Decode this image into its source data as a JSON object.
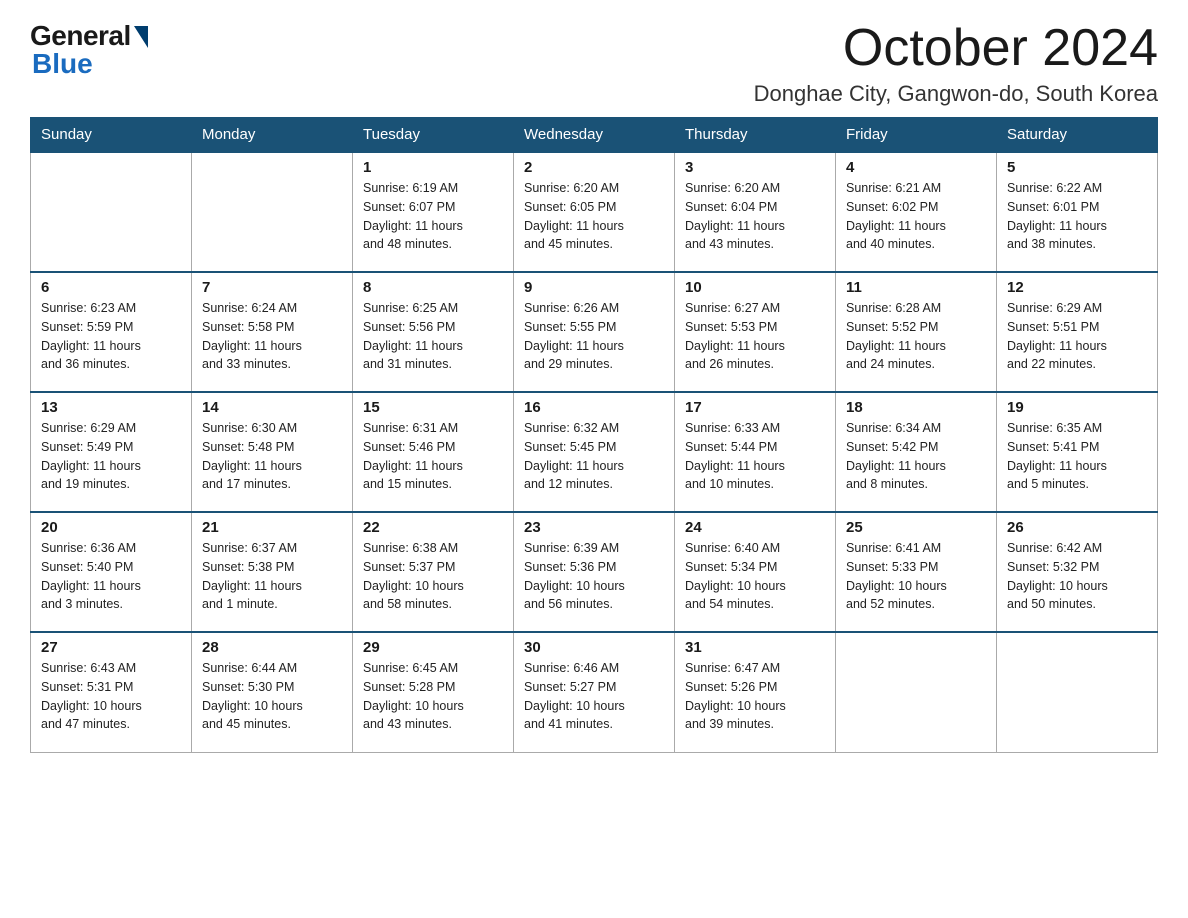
{
  "header": {
    "logo_general": "General",
    "logo_blue": "Blue",
    "month": "October 2024",
    "location": "Donghae City, Gangwon-do, South Korea"
  },
  "days_of_week": [
    "Sunday",
    "Monday",
    "Tuesday",
    "Wednesday",
    "Thursday",
    "Friday",
    "Saturday"
  ],
  "weeks": [
    [
      {
        "day": "",
        "info": ""
      },
      {
        "day": "",
        "info": ""
      },
      {
        "day": "1",
        "info": "Sunrise: 6:19 AM\nSunset: 6:07 PM\nDaylight: 11 hours\nand 48 minutes."
      },
      {
        "day": "2",
        "info": "Sunrise: 6:20 AM\nSunset: 6:05 PM\nDaylight: 11 hours\nand 45 minutes."
      },
      {
        "day": "3",
        "info": "Sunrise: 6:20 AM\nSunset: 6:04 PM\nDaylight: 11 hours\nand 43 minutes."
      },
      {
        "day": "4",
        "info": "Sunrise: 6:21 AM\nSunset: 6:02 PM\nDaylight: 11 hours\nand 40 minutes."
      },
      {
        "day": "5",
        "info": "Sunrise: 6:22 AM\nSunset: 6:01 PM\nDaylight: 11 hours\nand 38 minutes."
      }
    ],
    [
      {
        "day": "6",
        "info": "Sunrise: 6:23 AM\nSunset: 5:59 PM\nDaylight: 11 hours\nand 36 minutes."
      },
      {
        "day": "7",
        "info": "Sunrise: 6:24 AM\nSunset: 5:58 PM\nDaylight: 11 hours\nand 33 minutes."
      },
      {
        "day": "8",
        "info": "Sunrise: 6:25 AM\nSunset: 5:56 PM\nDaylight: 11 hours\nand 31 minutes."
      },
      {
        "day": "9",
        "info": "Sunrise: 6:26 AM\nSunset: 5:55 PM\nDaylight: 11 hours\nand 29 minutes."
      },
      {
        "day": "10",
        "info": "Sunrise: 6:27 AM\nSunset: 5:53 PM\nDaylight: 11 hours\nand 26 minutes."
      },
      {
        "day": "11",
        "info": "Sunrise: 6:28 AM\nSunset: 5:52 PM\nDaylight: 11 hours\nand 24 minutes."
      },
      {
        "day": "12",
        "info": "Sunrise: 6:29 AM\nSunset: 5:51 PM\nDaylight: 11 hours\nand 22 minutes."
      }
    ],
    [
      {
        "day": "13",
        "info": "Sunrise: 6:29 AM\nSunset: 5:49 PM\nDaylight: 11 hours\nand 19 minutes."
      },
      {
        "day": "14",
        "info": "Sunrise: 6:30 AM\nSunset: 5:48 PM\nDaylight: 11 hours\nand 17 minutes."
      },
      {
        "day": "15",
        "info": "Sunrise: 6:31 AM\nSunset: 5:46 PM\nDaylight: 11 hours\nand 15 minutes."
      },
      {
        "day": "16",
        "info": "Sunrise: 6:32 AM\nSunset: 5:45 PM\nDaylight: 11 hours\nand 12 minutes."
      },
      {
        "day": "17",
        "info": "Sunrise: 6:33 AM\nSunset: 5:44 PM\nDaylight: 11 hours\nand 10 minutes."
      },
      {
        "day": "18",
        "info": "Sunrise: 6:34 AM\nSunset: 5:42 PM\nDaylight: 11 hours\nand 8 minutes."
      },
      {
        "day": "19",
        "info": "Sunrise: 6:35 AM\nSunset: 5:41 PM\nDaylight: 11 hours\nand 5 minutes."
      }
    ],
    [
      {
        "day": "20",
        "info": "Sunrise: 6:36 AM\nSunset: 5:40 PM\nDaylight: 11 hours\nand 3 minutes."
      },
      {
        "day": "21",
        "info": "Sunrise: 6:37 AM\nSunset: 5:38 PM\nDaylight: 11 hours\nand 1 minute."
      },
      {
        "day": "22",
        "info": "Sunrise: 6:38 AM\nSunset: 5:37 PM\nDaylight: 10 hours\nand 58 minutes."
      },
      {
        "day": "23",
        "info": "Sunrise: 6:39 AM\nSunset: 5:36 PM\nDaylight: 10 hours\nand 56 minutes."
      },
      {
        "day": "24",
        "info": "Sunrise: 6:40 AM\nSunset: 5:34 PM\nDaylight: 10 hours\nand 54 minutes."
      },
      {
        "day": "25",
        "info": "Sunrise: 6:41 AM\nSunset: 5:33 PM\nDaylight: 10 hours\nand 52 minutes."
      },
      {
        "day": "26",
        "info": "Sunrise: 6:42 AM\nSunset: 5:32 PM\nDaylight: 10 hours\nand 50 minutes."
      }
    ],
    [
      {
        "day": "27",
        "info": "Sunrise: 6:43 AM\nSunset: 5:31 PM\nDaylight: 10 hours\nand 47 minutes."
      },
      {
        "day": "28",
        "info": "Sunrise: 6:44 AM\nSunset: 5:30 PM\nDaylight: 10 hours\nand 45 minutes."
      },
      {
        "day": "29",
        "info": "Sunrise: 6:45 AM\nSunset: 5:28 PM\nDaylight: 10 hours\nand 43 minutes."
      },
      {
        "day": "30",
        "info": "Sunrise: 6:46 AM\nSunset: 5:27 PM\nDaylight: 10 hours\nand 41 minutes."
      },
      {
        "day": "31",
        "info": "Sunrise: 6:47 AM\nSunset: 5:26 PM\nDaylight: 10 hours\nand 39 minutes."
      },
      {
        "day": "",
        "info": ""
      },
      {
        "day": "",
        "info": ""
      }
    ]
  ]
}
